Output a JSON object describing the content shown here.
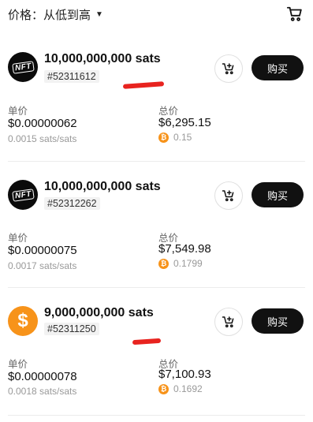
{
  "sort": {
    "label": "价格：从低到高"
  },
  "listings": [
    {
      "avatar_text": "NFT",
      "amount": "10,000,000,000 sats",
      "id": "#52311612",
      "buy_label": "购买",
      "unit_label": "单价",
      "unit_price_usd": "$0.00000062",
      "unit_price_sats": "0.0015 sats/sats",
      "total_label": "总价",
      "total_usd": "$6,295.15",
      "total_btc": "0.15"
    },
    {
      "avatar_text": "NFT",
      "amount": "10,000,000,000 sats",
      "id": "#52312262",
      "buy_label": "购买",
      "unit_label": "单价",
      "unit_price_usd": "$0.00000075",
      "unit_price_sats": "0.0017 sats/sats",
      "total_label": "总价",
      "total_usd": "$7,549.98",
      "total_btc": "0.1799"
    },
    {
      "avatar_text": "$",
      "amount": "9,000,000,000 sats",
      "id": "#52311250",
      "buy_label": "购买",
      "unit_label": "单价",
      "unit_price_usd": "$0.00000078",
      "unit_price_sats": "0.0018 sats/sats",
      "total_label": "总价",
      "total_usd": "$7,100.93",
      "total_btc": "0.1692"
    }
  ],
  "colors": {
    "accent": "#111111",
    "bitcoin": "#f7931a",
    "redaction": "#e8231f"
  },
  "icons": {
    "cart": "cart-icon",
    "add_to_cart": "cart-plus-icon",
    "btc": "bitcoin-icon",
    "caret": "caret-down-icon"
  }
}
